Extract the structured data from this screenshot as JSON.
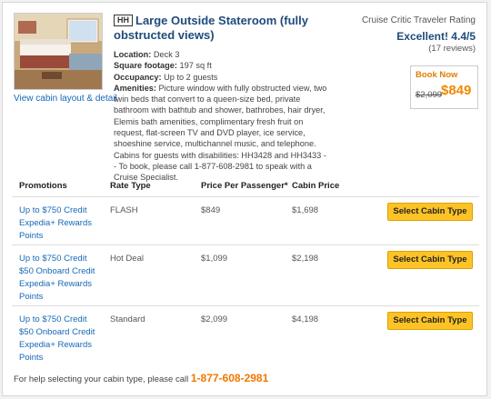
{
  "cabin": {
    "category_code": "HH",
    "title": "Large Outside Stateroom (fully obstructed views)",
    "layout_link": "View cabin layout & detail",
    "location_label": "Location:",
    "location": "Deck 3",
    "footage_label": "Square footage:",
    "footage": "197 sq ft",
    "occupancy_label": "Occupancy:",
    "occupancy": "Up to 2 guests",
    "amenities_label": "Amenities:",
    "amenities": "Picture window with fully obstructed view, two twin beds that convert to a queen-size bed, private bathroom with bathtub and shower, bathrobes, hair dryer, Elemis bath amenities, complimentary fresh fruit on request, flat-screen TV and DVD player, ice service, shoeshine service, multichannel music, and telephone. Cabins for guests with disabilities: HH3428 and HH3433 -- To book, please call 1-877-608-2981 to speak with a Cruise Specialist."
  },
  "rating": {
    "label": "Cruise Critic Traveler Rating",
    "value": "Excellent! 4.4/5",
    "reviews": "(17 reviews)"
  },
  "booking": {
    "label": "Book Now",
    "old_price": "$2,099",
    "new_price": "$849"
  },
  "table": {
    "headers": [
      "Promotions",
      "Rate Type",
      "Price Per Passenger*",
      "Cabin Price"
    ],
    "button_label": "Select Cabin Type",
    "rows": [
      {
        "promo": [
          "Up to $750 Credit",
          "Expedia+ Rewards",
          "Points"
        ],
        "rate_type": "FLASH",
        "price": "$849",
        "cabin_price": "$1,698"
      },
      {
        "promo": [
          "Up to $750 Credit",
          "$50 Onboard Credit",
          "Expedia+ Rewards",
          "Points"
        ],
        "rate_type": "Hot Deal",
        "price": "$1,099",
        "cabin_price": "$2,198"
      },
      {
        "promo": [
          "Up to $750 Credit",
          "$50 Onboard Credit",
          "Expedia+ Rewards",
          "Points"
        ],
        "rate_type": "Standard",
        "price": "$2,099",
        "cabin_price": "$4,198"
      }
    ]
  },
  "help": {
    "text": "For help selecting your cabin type, please call",
    "phone": "1-877-608-2981"
  }
}
